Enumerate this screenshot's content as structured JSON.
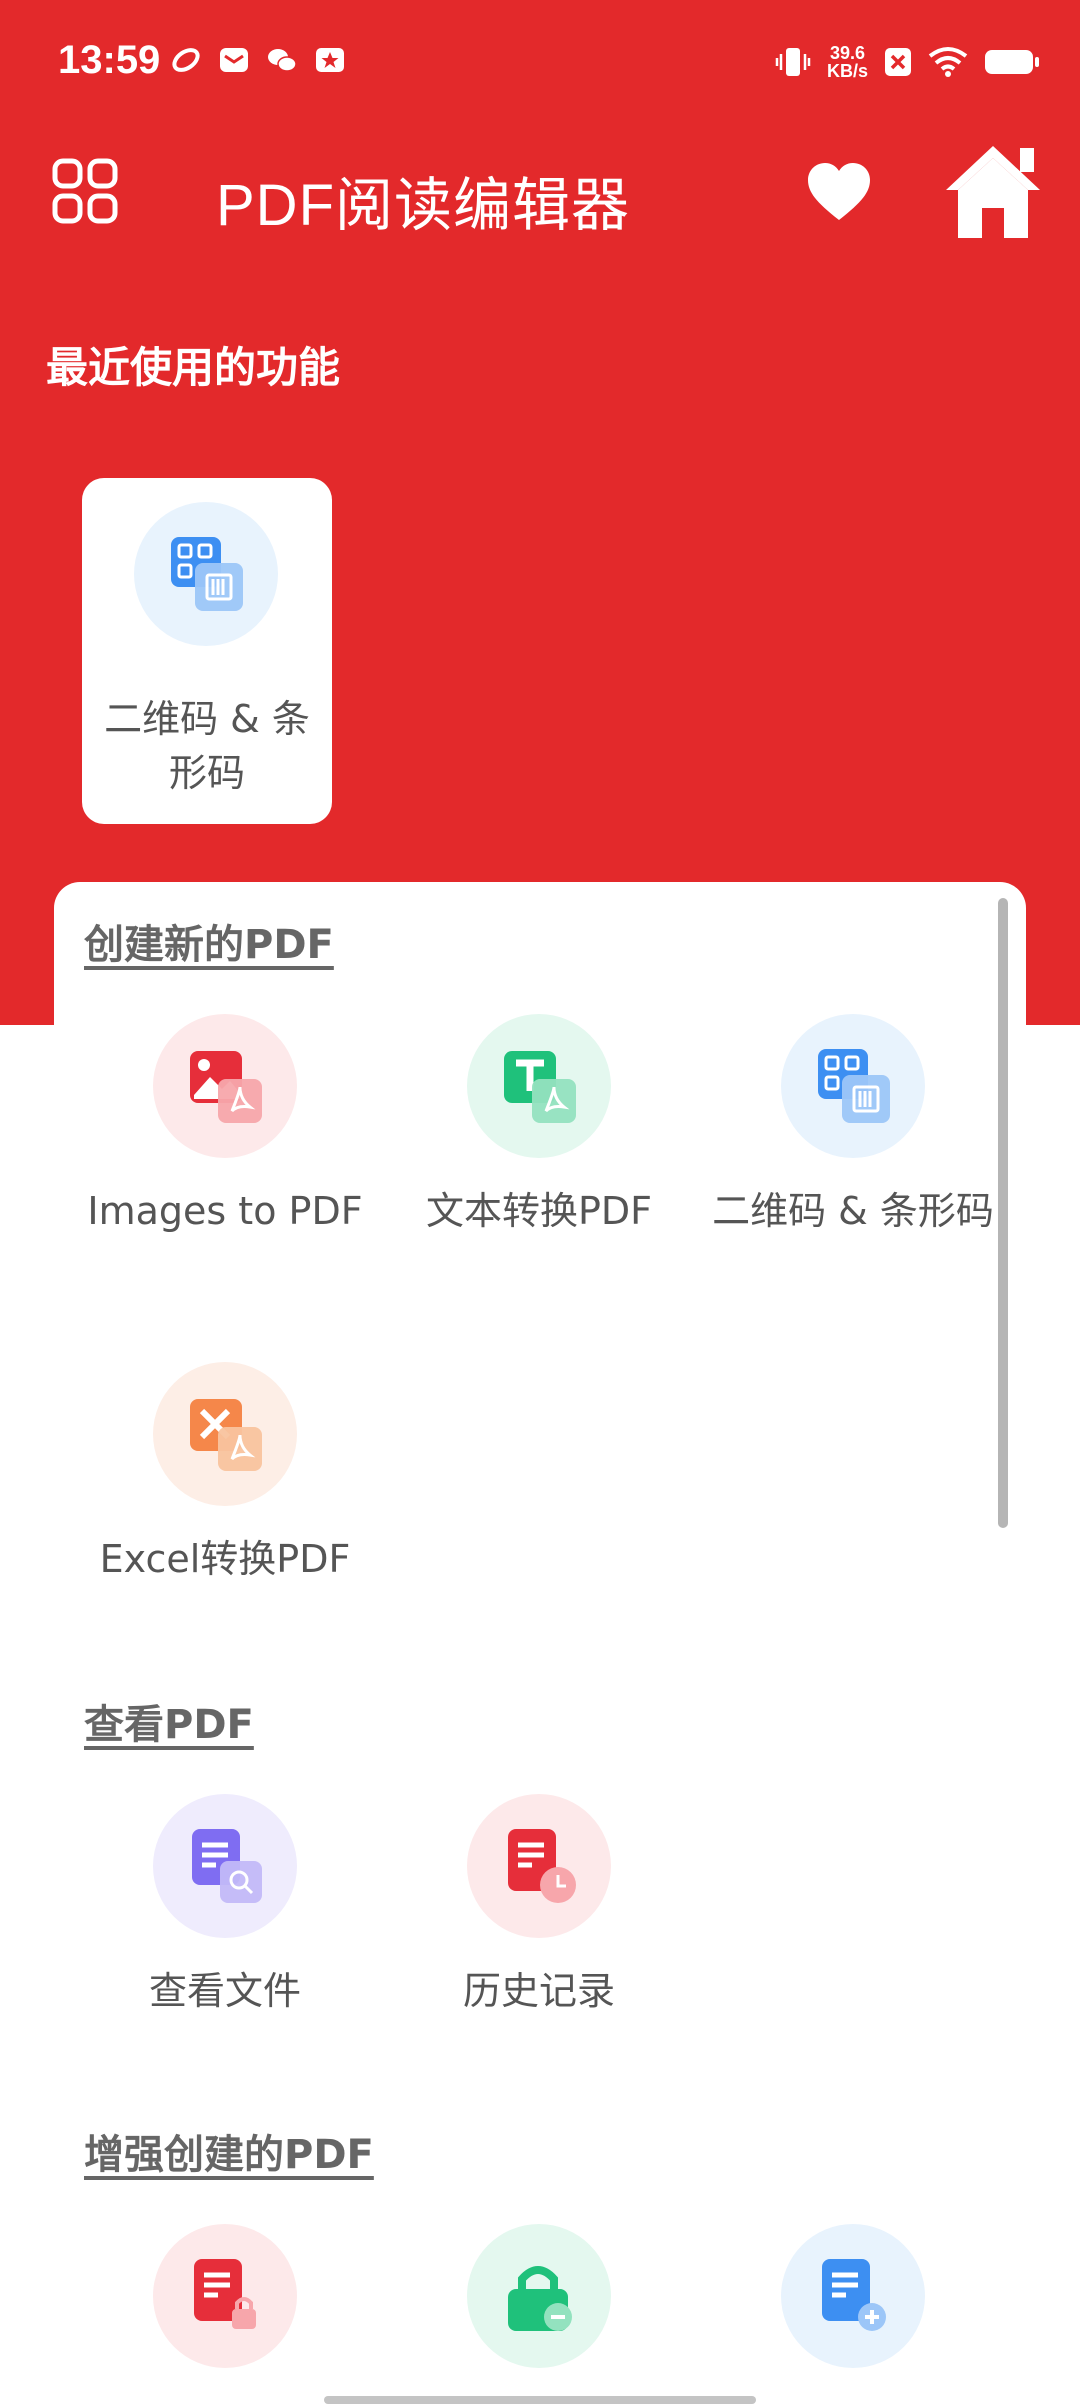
{
  "status_bar": {
    "time": "13:59",
    "net_speed_value": "39.6",
    "net_speed_unit": "KB/s"
  },
  "app_bar": {
    "title": "PDF阅读编辑器"
  },
  "recent": {
    "title": "最近使用的功能",
    "items": [
      {
        "label": "二维码 & 条形码",
        "icon": "qr-barcode-icon"
      }
    ]
  },
  "sections": [
    {
      "title": "创建新的PDF",
      "items": [
        {
          "label": "Images to PDF",
          "icon": "image-to-pdf-icon"
        },
        {
          "label": "文本转换PDF",
          "icon": "text-to-pdf-icon"
        },
        {
          "label": "二维码 & 条形码",
          "icon": "qr-barcode-icon"
        },
        {
          "label": "Excel转换PDF",
          "icon": "excel-to-pdf-icon"
        }
      ]
    },
    {
      "title": "查看PDF",
      "items": [
        {
          "label": "查看文件",
          "icon": "view-file-icon"
        },
        {
          "label": "历史记录",
          "icon": "history-icon"
        }
      ]
    },
    {
      "title": "增强创建的PDF",
      "items": [
        {
          "label": "",
          "icon": "lock-pdf-icon"
        },
        {
          "label": "",
          "icon": "unlock-pdf-icon"
        },
        {
          "label": "",
          "icon": "add-page-icon"
        }
      ]
    }
  ],
  "colors": {
    "brand_red": "#e3292b",
    "icon_red": "#e62e3a",
    "icon_green": "#1fc17b",
    "icon_blue": "#3d8ff2",
    "icon_orange": "#f5874a",
    "icon_purple": "#7f6df2"
  }
}
